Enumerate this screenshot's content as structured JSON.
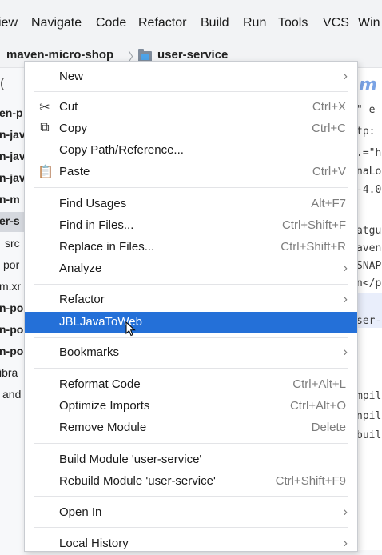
{
  "menubar": {
    "items": [
      "iew",
      "Navigate",
      "Code",
      "Refactor",
      "Build",
      "Run",
      "Tools",
      "VCS",
      "Win"
    ]
  },
  "breadcrumb": {
    "project": "maven-micro-shop",
    "module": "user-service"
  },
  "tree": {
    "items": [
      "en-p",
      "n-jav",
      "n-jav",
      "n-jav",
      "n-m",
      "er-s",
      "src",
      "por",
      "m.xr",
      "n-po",
      "n-po",
      "n-po",
      "ibra",
      "and"
    ]
  },
  "editor": {
    "lines": [
      "\" e",
      "tp:",
      ".=\"h",
      "naLo",
      "-4.0",
      "atgu",
      "aven",
      "SNAP",
      "n</p",
      "ser-",
      "mpile",
      "npile",
      "buil"
    ]
  },
  "context_menu": {
    "items": [
      {
        "label": "New",
        "shortcut": "",
        "submenu": true
      },
      {
        "label": "Cut",
        "shortcut": "Ctrl+X",
        "icon": "scissors-icon"
      },
      {
        "label": "Copy",
        "shortcut": "Ctrl+C",
        "icon": "copy-icon"
      },
      {
        "label": "Copy Path/Reference...",
        "shortcut": ""
      },
      {
        "label": "Paste",
        "shortcut": "Ctrl+V",
        "icon": "clipboard-icon"
      },
      {
        "label": "Find Usages",
        "shortcut": "Alt+F7"
      },
      {
        "label": "Find in Files...",
        "shortcut": "Ctrl+Shift+F"
      },
      {
        "label": "Replace in Files...",
        "shortcut": "Ctrl+Shift+R"
      },
      {
        "label": "Analyze",
        "shortcut": "",
        "submenu": true
      },
      {
        "label": "Refactor",
        "shortcut": "",
        "submenu": true
      },
      {
        "label": "JBLJavaToWeb",
        "shortcut": "",
        "highlighted": true
      },
      {
        "label": "Bookmarks",
        "shortcut": "",
        "submenu": true
      },
      {
        "label": "Reformat Code",
        "shortcut": "Ctrl+Alt+L"
      },
      {
        "label": "Optimize Imports",
        "shortcut": "Ctrl+Alt+O"
      },
      {
        "label": "Remove Module",
        "shortcut": "Delete"
      },
      {
        "label": "Build Module 'user-service'",
        "shortcut": ""
      },
      {
        "label": "Rebuild Module 'user-service'",
        "shortcut": "Ctrl+Shift+F9"
      },
      {
        "label": "Open In",
        "shortcut": "",
        "submenu": true
      },
      {
        "label": "Local History",
        "shortcut": "",
        "submenu": true
      }
    ]
  },
  "colors": {
    "highlight": "#2470d8",
    "menu_bg": "#ffffff",
    "shortcut": "#7d7d7d"
  }
}
